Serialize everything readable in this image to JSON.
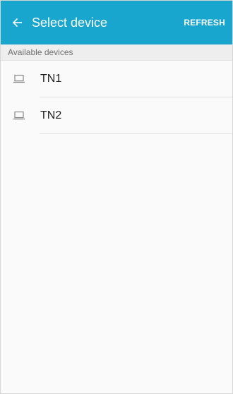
{
  "app_bar": {
    "title": "Select device",
    "refresh_label": "REFRESH",
    "back_icon": "arrow-left-icon",
    "background_color": "#18a6cf"
  },
  "section": {
    "header": "Available devices"
  },
  "devices": [
    {
      "name": "TN1",
      "icon": "laptop-icon"
    },
    {
      "name": "TN2",
      "icon": "laptop-icon"
    }
  ]
}
